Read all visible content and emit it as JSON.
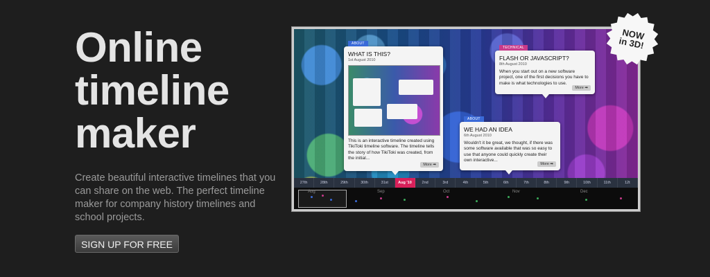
{
  "hero": {
    "title_lines": [
      "Online",
      "timeline",
      "maker"
    ],
    "description": "Create beautiful interactive timelines that you can share on the web. The perfect timeline maker for company history timelines and school projects.",
    "signup_label": "SIGN UP FOR FREE"
  },
  "badge": {
    "line1": "NOW",
    "line2": "in 3D!"
  },
  "cards": {
    "about1": {
      "category": "ABOUT",
      "title": "WHAT IS THIS?",
      "date": "1st August 2010",
      "body": "This is an interactive timeline created using TikiToki timeline software. The timeline tells the story of how TikiToki was created, from the initial...",
      "more": "More"
    },
    "technical": {
      "category": "TECHNICAL",
      "title": "FLASH OR JAVASCRIPT?",
      "date": "8th August 2010",
      "body": "When you start out on a new software project, one of the first decisions you have to make is what technologies to use.",
      "more": "More"
    },
    "about2": {
      "category": "ABOUT",
      "title": "WE HAD AN IDEA",
      "date": "6th August 2010",
      "body": "Wouldn't it be great, we thought, if there was some software available that was so easy to use that anyone could quickly create their own interactive...",
      "more": "More"
    }
  },
  "axis": {
    "ticks": [
      "27th",
      "28th",
      "29th",
      "30th",
      "31st",
      "Aug '10",
      "2nd",
      "3rd",
      "4th",
      "5th",
      "6th",
      "7th",
      "8th",
      "9th",
      "10th",
      "11th",
      "12t"
    ],
    "active_index": 5
  },
  "overview": {
    "months": [
      "Aug",
      "Sep",
      "Oct",
      "Nov",
      "Dec"
    ]
  },
  "colors": {
    "about": "#3a6ad8",
    "technical": "#c83a8a",
    "active_tick": "#d8205a"
  }
}
